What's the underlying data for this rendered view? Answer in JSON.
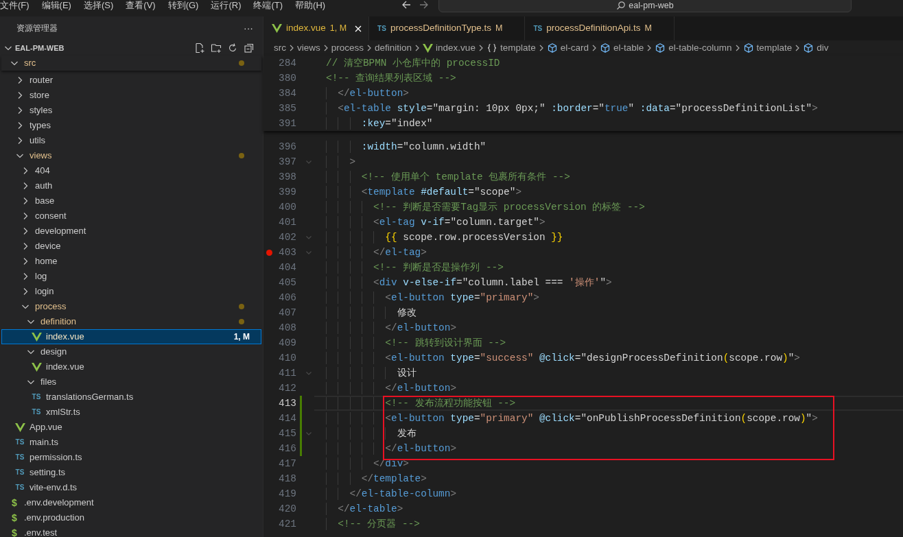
{
  "menu": [
    "文件(F)",
    "编辑(E)",
    "选择(S)",
    "查看(V)",
    "转到(G)",
    "运行(R)",
    "终端(T)",
    "帮助(H)"
  ],
  "command_center": {
    "text": "eal-pm-web"
  },
  "explorer": {
    "title": "资源管理器",
    "more": "···",
    "project": {
      "label": "EAL-PM-WEB",
      "expanded": true
    },
    "tree": [
      {
        "label": "src",
        "kind": "folder",
        "expanded": true,
        "modified": true,
        "selected": false,
        "children": [
          {
            "label": "router",
            "kind": "folder",
            "expanded": false,
            "modified": false,
            "selected": false
          },
          {
            "label": "store",
            "kind": "folder",
            "expanded": false,
            "modified": false,
            "selected": false
          },
          {
            "label": "styles",
            "kind": "folder",
            "expanded": false,
            "modified": false,
            "selected": false
          },
          {
            "label": "types",
            "kind": "folder",
            "expanded": false,
            "modified": false,
            "selected": false
          },
          {
            "label": "utils",
            "kind": "folder",
            "expanded": false,
            "modified": false,
            "selected": false
          },
          {
            "label": "views",
            "kind": "folder",
            "expanded": true,
            "modified": true,
            "selected": false,
            "children": [
              {
                "label": "404",
                "kind": "folder",
                "expanded": false,
                "modified": false,
                "selected": false
              },
              {
                "label": "auth",
                "kind": "folder",
                "expanded": false,
                "modified": false,
                "selected": false
              },
              {
                "label": "base",
                "kind": "folder",
                "expanded": false,
                "modified": false,
                "selected": false
              },
              {
                "label": "consent",
                "kind": "folder",
                "expanded": false,
                "modified": false,
                "selected": false
              },
              {
                "label": "development",
                "kind": "folder",
                "expanded": false,
                "modified": false,
                "selected": false
              },
              {
                "label": "device",
                "kind": "folder",
                "expanded": false,
                "modified": false,
                "selected": false
              },
              {
                "label": "home",
                "kind": "folder",
                "expanded": false,
                "modified": false,
                "selected": false
              },
              {
                "label": "log",
                "kind": "folder",
                "expanded": false,
                "modified": false,
                "selected": false
              },
              {
                "label": "login",
                "kind": "folder",
                "expanded": false,
                "modified": false,
                "selected": false
              },
              {
                "label": "process",
                "kind": "folder",
                "expanded": true,
                "modified": true,
                "selected": false,
                "children": [
                  {
                    "label": "definition",
                    "kind": "folder",
                    "expanded": true,
                    "modified": true,
                    "selected": false,
                    "children": [
                      {
                        "label": "index.vue",
                        "kind": "vue",
                        "modified": true,
                        "selected": true,
                        "badge": "1, M"
                      }
                    ]
                  },
                  {
                    "label": "design",
                    "kind": "folder",
                    "expanded": true,
                    "modified": false,
                    "selected": false,
                    "children": [
                      {
                        "label": "index.vue",
                        "kind": "vue",
                        "modified": false,
                        "selected": false
                      }
                    ]
                  },
                  {
                    "label": "files",
                    "kind": "folder",
                    "expanded": true,
                    "modified": false,
                    "selected": false,
                    "children": [
                      {
                        "label": "translationsGerman.ts",
                        "kind": "ts",
                        "icon": "TS",
                        "modified": false,
                        "selected": false
                      },
                      {
                        "label": "xmlStr.ts",
                        "kind": "ts",
                        "icon": "TS",
                        "modified": false,
                        "selected": false
                      }
                    ]
                  }
                ]
              }
            ]
          },
          {
            "label": "App.vue",
            "kind": "vue",
            "modified": false,
            "selected": false
          },
          {
            "label": "main.ts",
            "kind": "ts",
            "icon": "TS",
            "modified": false,
            "selected": false
          },
          {
            "label": "permission.ts",
            "kind": "ts",
            "icon": "TS",
            "modified": false,
            "selected": false
          },
          {
            "label": "setting.ts",
            "kind": "ts",
            "icon": "TS",
            "modified": false,
            "selected": false
          },
          {
            "label": "vite-env.d.ts",
            "kind": "ts",
            "icon": "TS",
            "modified": false,
            "selected": false
          }
        ]
      },
      {
        "label": ".env.development",
        "kind": "env",
        "icon": "$",
        "modified": false,
        "selected": false
      },
      {
        "label": ".env.production",
        "kind": "env",
        "icon": "$",
        "modified": false,
        "selected": false
      },
      {
        "label": ".env.test",
        "kind": "env",
        "icon": "$",
        "modified": false,
        "selected": false
      }
    ]
  },
  "tabs": [
    {
      "label": "index.vue",
      "kind": "vue",
      "badge": "1, M",
      "problem": true,
      "selected": true
    },
    {
      "label": "processDefinitionType.ts",
      "kind": "ts",
      "icon": "TS",
      "badge": "M",
      "problem": false,
      "selected": false
    },
    {
      "label": "processDefinitionApi.ts",
      "kind": "ts",
      "icon": "TS",
      "badge": "M",
      "problem": false,
      "selected": false
    }
  ],
  "breadcrumbs": [
    {
      "kind": "folder",
      "label": "src"
    },
    {
      "kind": "folder",
      "label": "views"
    },
    {
      "kind": "folder",
      "label": "process"
    },
    {
      "kind": "folder",
      "label": "definition"
    },
    {
      "kind": "vue",
      "label": "index.vue"
    },
    {
      "kind": "braces",
      "label": "template"
    },
    {
      "kind": "element",
      "label": "el-card"
    },
    {
      "kind": "element",
      "label": "el-table"
    },
    {
      "kind": "element",
      "label": "el-table-column"
    },
    {
      "kind": "element",
      "label": "template"
    },
    {
      "kind": "element",
      "label": "div"
    }
  ],
  "editor": {
    "sticky_lines": [
      {
        "number": "284",
        "tokens": [
          {
            "kind": "comment",
            "text": "// 清空BPMN 小仓库中的 processID"
          }
        ]
      },
      {
        "number": "380",
        "tokens": [
          {
            "kind": "comment",
            "text": "<!-- 查询结果列表区域 -->"
          }
        ]
      },
      {
        "number": "384",
        "tokens": [
          {
            "kind": "punct",
            "text": "  </"
          },
          {
            "kind": "tag",
            "text": "el-button"
          },
          {
            "kind": "punct",
            "text": ">"
          }
        ]
      },
      {
        "number": "385",
        "tokens": [
          {
            "kind": "punct",
            "text": "  <"
          },
          {
            "kind": "tag",
            "text": "el-table"
          },
          {
            "kind": "attr",
            "text": " style"
          },
          {
            "kind": "plain",
            "text": "=\"margin: 10px 0px;\""
          },
          {
            "kind": "attr",
            "text": " :border"
          },
          {
            "kind": "plain",
            "text": "=\""
          },
          {
            "kind": "tag",
            "text": "true"
          },
          {
            "kind": "plain",
            "text": "\""
          },
          {
            "kind": "attr",
            "text": " :data"
          },
          {
            "kind": "plain",
            "text": "=\"processDefinitionList\""
          },
          {
            "kind": "punct",
            "text": ">"
          }
        ]
      },
      {
        "number": "391",
        "tokens": [
          {
            "kind": "attr",
            "text": "      :key"
          },
          {
            "kind": "plain",
            "text": "=\"index\""
          }
        ]
      }
    ],
    "lines": [
      {
        "number": "396",
        "current": false,
        "changed": false,
        "fold": false,
        "breakpoint": false,
        "highlighted": false,
        "tokens": [
          {
            "kind": "attr",
            "text": "      :width"
          },
          {
            "kind": "plain",
            "text": "=\"column.width\""
          }
        ]
      },
      {
        "number": "397",
        "current": false,
        "changed": false,
        "fold": true,
        "breakpoint": false,
        "highlighted": false,
        "tokens": [
          {
            "kind": "punct",
            "text": "    >"
          }
        ]
      },
      {
        "number": "398",
        "current": false,
        "changed": false,
        "fold": false,
        "breakpoint": false,
        "highlighted": false,
        "tokens": [
          {
            "kind": "comment",
            "text": "      <!-- 使用单个 template 包裹所有条件 -->"
          }
        ]
      },
      {
        "number": "399",
        "current": false,
        "changed": false,
        "fold": false,
        "breakpoint": false,
        "highlighted": false,
        "tokens": [
          {
            "kind": "punct",
            "text": "      <"
          },
          {
            "kind": "tag",
            "text": "template"
          },
          {
            "kind": "attr",
            "text": " #default"
          },
          {
            "kind": "plain",
            "text": "=\"scope\""
          },
          {
            "kind": "punct",
            "text": ">"
          }
        ]
      },
      {
        "number": "400",
        "current": false,
        "changed": false,
        "fold": false,
        "breakpoint": false,
        "highlighted": false,
        "tokens": [
          {
            "kind": "comment",
            "text": "        <!-- 判断是否需要Tag显示 processVersion 的标签 -->"
          }
        ]
      },
      {
        "number": "401",
        "current": false,
        "changed": false,
        "fold": false,
        "breakpoint": false,
        "highlighted": false,
        "tokens": [
          {
            "kind": "punct",
            "text": "        <"
          },
          {
            "kind": "tag",
            "text": "el-tag"
          },
          {
            "kind": "attr",
            "text": " v-if"
          },
          {
            "kind": "plain",
            "text": "=\"column.target\""
          },
          {
            "kind": "punct",
            "text": ">"
          }
        ]
      },
      {
        "number": "402",
        "current": false,
        "changed": false,
        "fold": true,
        "breakpoint": false,
        "highlighted": false,
        "tokens": [
          {
            "kind": "bracket",
            "text": "          {{"
          },
          {
            "kind": "plain",
            "text": " scope.row.processVersion "
          },
          {
            "kind": "bracket",
            "text": "}}"
          }
        ]
      },
      {
        "number": "403",
        "current": false,
        "changed": false,
        "fold": true,
        "breakpoint": true,
        "highlighted": false,
        "tokens": [
          {
            "kind": "punct",
            "text": "        </"
          },
          {
            "kind": "tag",
            "text": "el-tag"
          },
          {
            "kind": "punct",
            "text": ">"
          }
        ]
      },
      {
        "number": "404",
        "current": false,
        "changed": false,
        "fold": false,
        "breakpoint": false,
        "highlighted": false,
        "tokens": [
          {
            "kind": "comment",
            "text": "        <!-- 判断是否是操作列 -->"
          }
        ]
      },
      {
        "number": "405",
        "current": false,
        "changed": false,
        "fold": false,
        "breakpoint": false,
        "highlighted": false,
        "tokens": [
          {
            "kind": "punct",
            "text": "        <"
          },
          {
            "kind": "tag",
            "text": "div"
          },
          {
            "kind": "attr",
            "text": " v-else-if"
          },
          {
            "kind": "plain",
            "text": "=\"column.label === "
          },
          {
            "kind": "string",
            "text": "'操作'"
          },
          {
            "kind": "plain",
            "text": "\""
          },
          {
            "kind": "punct",
            "text": ">"
          }
        ]
      },
      {
        "number": "406",
        "current": false,
        "changed": false,
        "fold": false,
        "breakpoint": false,
        "highlighted": false,
        "tokens": [
          {
            "kind": "punct",
            "text": "          <"
          },
          {
            "kind": "tag",
            "text": "el-button"
          },
          {
            "kind": "attr",
            "text": " type"
          },
          {
            "kind": "plain",
            "text": "="
          },
          {
            "kind": "string",
            "text": "\"primary\""
          },
          {
            "kind": "punct",
            "text": ">"
          }
        ]
      },
      {
        "number": "407",
        "current": false,
        "changed": false,
        "fold": false,
        "breakpoint": false,
        "highlighted": false,
        "tokens": [
          {
            "kind": "plain",
            "text": "            修改"
          }
        ]
      },
      {
        "number": "408",
        "current": false,
        "changed": false,
        "fold": false,
        "breakpoint": false,
        "highlighted": false,
        "tokens": [
          {
            "kind": "punct",
            "text": "          </"
          },
          {
            "kind": "tag",
            "text": "el-button"
          },
          {
            "kind": "punct",
            "text": ">"
          }
        ]
      },
      {
        "number": "409",
        "current": false,
        "changed": false,
        "fold": false,
        "breakpoint": false,
        "highlighted": false,
        "tokens": [
          {
            "kind": "comment",
            "text": "          <!-- 跳转到设计界面 -->"
          }
        ]
      },
      {
        "number": "410",
        "current": false,
        "changed": false,
        "fold": false,
        "breakpoint": false,
        "highlighted": false,
        "tokens": [
          {
            "kind": "punct",
            "text": "          <"
          },
          {
            "kind": "tag",
            "text": "el-button"
          },
          {
            "kind": "attr",
            "text": " type"
          },
          {
            "kind": "plain",
            "text": "="
          },
          {
            "kind": "string",
            "text": "\"success\""
          },
          {
            "kind": "attr",
            "text": " @click"
          },
          {
            "kind": "plain",
            "text": "=\"designProcessDefinition"
          },
          {
            "kind": "bracket",
            "text": "("
          },
          {
            "kind": "plain",
            "text": "scope.row"
          },
          {
            "kind": "bracket",
            "text": ")"
          },
          {
            "kind": "plain",
            "text": "\""
          },
          {
            "kind": "punct",
            "text": ">"
          }
        ]
      },
      {
        "number": "411",
        "current": false,
        "changed": false,
        "fold": true,
        "breakpoint": false,
        "highlighted": false,
        "tokens": [
          {
            "kind": "plain",
            "text": "            设计"
          }
        ]
      },
      {
        "number": "412",
        "current": false,
        "changed": false,
        "fold": false,
        "breakpoint": false,
        "highlighted": false,
        "tokens": [
          {
            "kind": "punct",
            "text": "          </"
          },
          {
            "kind": "tag",
            "text": "el-button"
          },
          {
            "kind": "punct",
            "text": ">"
          }
        ]
      },
      {
        "number": "413",
        "current": true,
        "changed": true,
        "fold": false,
        "breakpoint": false,
        "highlighted": true,
        "tokens": [
          {
            "kind": "comment",
            "text": "          <!-- 发布流程功能按钮 -->"
          }
        ]
      },
      {
        "number": "414",
        "current": false,
        "changed": true,
        "fold": false,
        "breakpoint": false,
        "highlighted": true,
        "tokens": [
          {
            "kind": "punct",
            "text": "          <"
          },
          {
            "kind": "tag",
            "text": "el-button"
          },
          {
            "kind": "attr",
            "text": " type"
          },
          {
            "kind": "plain",
            "text": "="
          },
          {
            "kind": "string",
            "text": "\"primary\""
          },
          {
            "kind": "attr",
            "text": " @click"
          },
          {
            "kind": "plain",
            "text": "=\"onPublishProcessDefinition"
          },
          {
            "kind": "bracket",
            "text": "("
          },
          {
            "kind": "plain",
            "text": "scope.row"
          },
          {
            "kind": "bracket",
            "text": ")"
          },
          {
            "kind": "plain",
            "text": "\""
          },
          {
            "kind": "punct",
            "text": ">"
          }
        ]
      },
      {
        "number": "415",
        "current": false,
        "changed": true,
        "fold": true,
        "breakpoint": false,
        "highlighted": true,
        "tokens": [
          {
            "kind": "plain",
            "text": "            发布"
          }
        ]
      },
      {
        "number": "416",
        "current": false,
        "changed": true,
        "fold": false,
        "breakpoint": false,
        "highlighted": true,
        "tokens": [
          {
            "kind": "punct",
            "text": "          </"
          },
          {
            "kind": "tag",
            "text": "el-button"
          },
          {
            "kind": "punct",
            "text": ">"
          }
        ]
      },
      {
        "number": "417",
        "current": false,
        "changed": false,
        "fold": false,
        "breakpoint": false,
        "highlighted": false,
        "tokens": [
          {
            "kind": "punct",
            "text": "        </"
          },
          {
            "kind": "tag",
            "text": "div"
          },
          {
            "kind": "punct",
            "text": ">"
          }
        ]
      },
      {
        "number": "418",
        "current": false,
        "changed": false,
        "fold": false,
        "breakpoint": false,
        "highlighted": false,
        "tokens": [
          {
            "kind": "punct",
            "text": "      </"
          },
          {
            "kind": "tag",
            "text": "template"
          },
          {
            "kind": "punct",
            "text": ">"
          }
        ]
      },
      {
        "number": "419",
        "current": false,
        "changed": false,
        "fold": false,
        "breakpoint": false,
        "highlighted": false,
        "tokens": [
          {
            "kind": "punct",
            "text": "    </"
          },
          {
            "kind": "tag",
            "text": "el-table-column"
          },
          {
            "kind": "punct",
            "text": ">"
          }
        ]
      },
      {
        "number": "420",
        "current": false,
        "changed": false,
        "fold": false,
        "breakpoint": false,
        "highlighted": false,
        "tokens": [
          {
            "kind": "punct",
            "text": "  </"
          },
          {
            "kind": "tag",
            "text": "el-table"
          },
          {
            "kind": "punct",
            "text": ">"
          }
        ]
      },
      {
        "number": "421",
        "current": false,
        "changed": false,
        "fold": false,
        "breakpoint": false,
        "highlighted": false,
        "tokens": [
          {
            "kind": "comment",
            "text": "  <!-- 分页器 -->"
          }
        ]
      }
    ]
  }
}
